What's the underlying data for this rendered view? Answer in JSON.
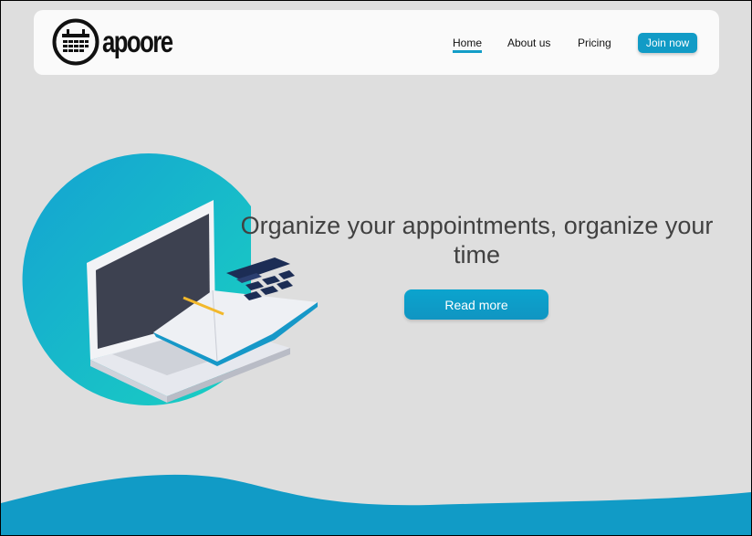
{
  "brand": {
    "name": "apoore",
    "logo_icon": "calendar-icon"
  },
  "nav": {
    "links": [
      "Home",
      "About us",
      "Pricing"
    ],
    "active": "Home",
    "join_label": "Join now"
  },
  "hero": {
    "headline": "Organize your appointments, organize your time",
    "cta_label": "Read more",
    "illustration": "laptop-notebook-calendar-illustration"
  },
  "colors": {
    "background": "#dedede",
    "accent": "#119bc6",
    "teal": "#1ec6c6",
    "navbar": "#fafafa",
    "text": "#414141"
  }
}
